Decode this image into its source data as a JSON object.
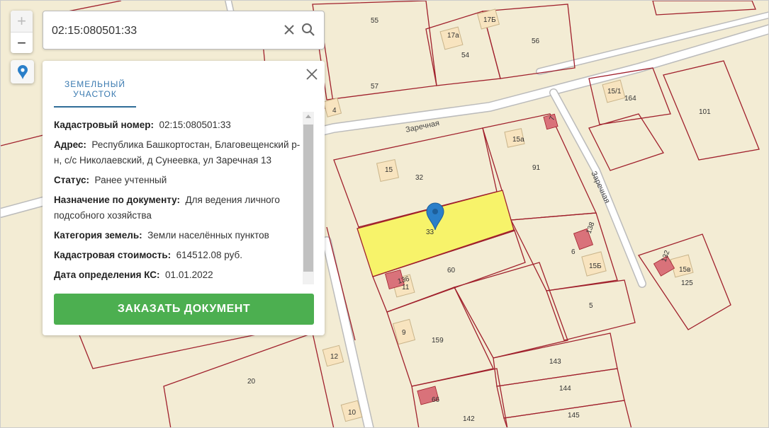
{
  "search": {
    "value": "02:15:080501:33"
  },
  "zoom": {
    "plus": "+",
    "minus": "−"
  },
  "panel": {
    "tab": "ЗЕМЕЛЬНЫЙ УЧАСТОК",
    "fields": [
      {
        "label": "Кадастровый номер:",
        "value": "02:15:080501:33"
      },
      {
        "label": "Адрес:",
        "value": "Республика Башкортостан, Благовещенский р-н, с/с Николаевский, д Сунеевка, ул Заречная 13"
      },
      {
        "label": "Статус:",
        "value": "Ранее учтенный"
      },
      {
        "label": "Назначение по документу:",
        "value": "Для ведения личного подсобного хозяйства"
      },
      {
        "label": "Категория земель:",
        "value": "Земли населённых пунктов"
      },
      {
        "label": "Кадастровая стоимость:",
        "value": "614512.08 руб."
      },
      {
        "label": "Дата определения КС:",
        "value": "01.01.2022"
      }
    ],
    "order_button": "ЗАКАЗАТЬ ДОКУМЕНТ"
  },
  "map": {
    "colors": {
      "background": "#f3ecd4",
      "parcel_border": "#a0202c",
      "selected": "#f7f36a",
      "building": "#f8e4bf",
      "building_red": "#d9727a",
      "marker": "#2a7fc9"
    },
    "streets": [
      "Заречная",
      "Заречная"
    ],
    "labels": [
      "55",
      "17Б",
      "17а",
      "54",
      "56",
      "57",
      "15/1",
      "164",
      "101",
      "15а",
      "91",
      "15",
      "32",
      "33",
      "60",
      "136",
      "11",
      "7",
      "138",
      "6",
      "15Б",
      "132",
      "15в",
      "125",
      "5",
      "9",
      "159",
      "143",
      "144",
      "145",
      "142",
      "66",
      "20",
      "12",
      "10",
      "4"
    ]
  },
  "icons": {
    "clear": "close-icon",
    "search": "search-icon",
    "locate": "map-pin-icon",
    "panel_close": "close-icon",
    "marker": "map-marker-icon"
  }
}
